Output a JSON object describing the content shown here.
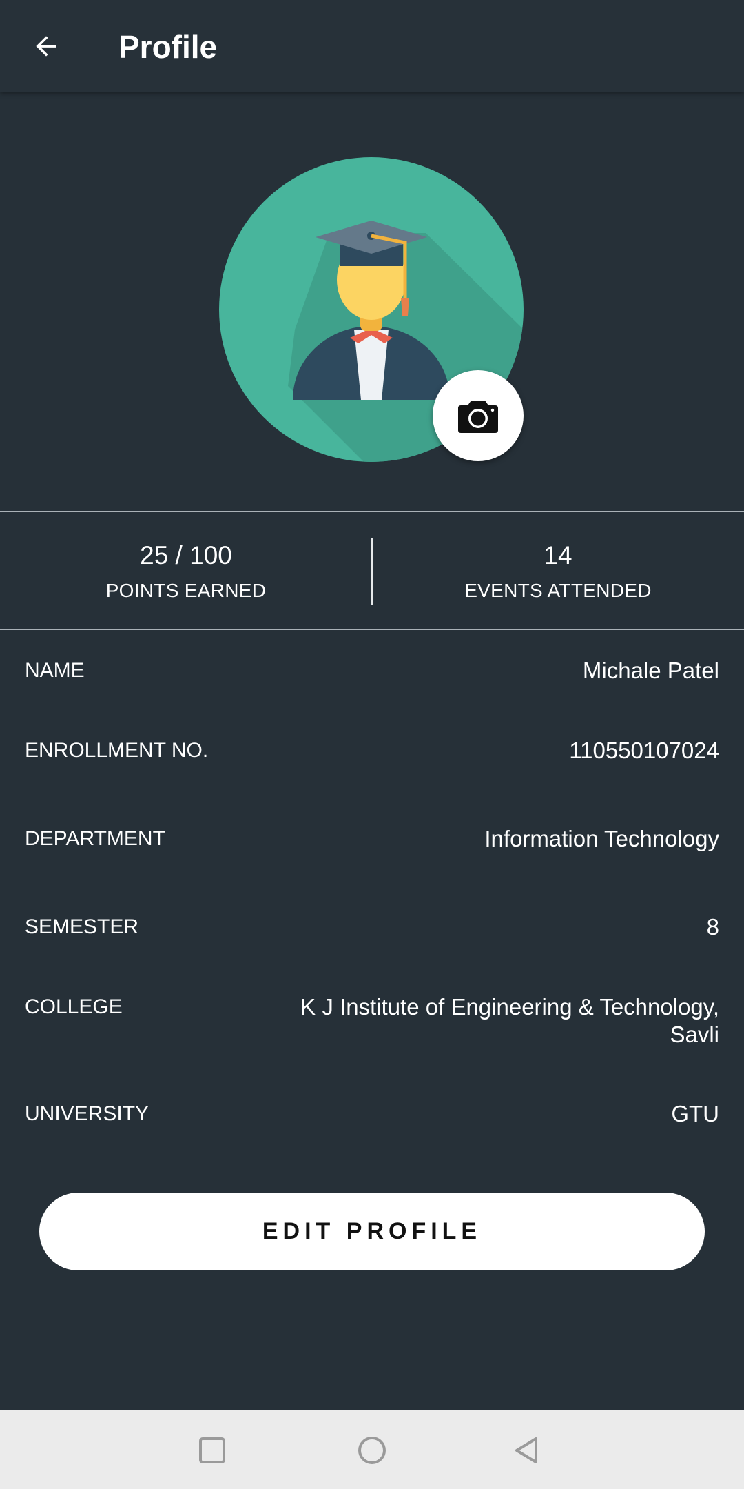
{
  "appbar": {
    "title": "Profile",
    "back_icon": "arrow-left-icon"
  },
  "avatar": {
    "icon": "graduate-avatar-icon",
    "camera_icon": "camera-icon",
    "colors": {
      "circle": "#48B59C",
      "shadow": "#3FA18B"
    }
  },
  "stats": [
    {
      "value": "25 / 100",
      "label": "POINTS EARNED"
    },
    {
      "value": "14",
      "label": "EVENTS ATTENDED"
    }
  ],
  "info": {
    "name": {
      "label": "NAME",
      "value": "Michale Patel"
    },
    "enrollment": {
      "label": "ENROLLMENT NO.",
      "value": "110550107024"
    },
    "department": {
      "label": "DEPARTMENT",
      "value": "Information Technology"
    },
    "semester": {
      "label": "SEMESTER",
      "value": "8"
    },
    "college": {
      "label": "COLLEGE",
      "value_line1": "K J Institute of Engineering & Technology,",
      "value_line2": "Savli"
    },
    "university": {
      "label": "UNIVERSITY",
      "value": "GTU"
    }
  },
  "edit_button": {
    "label": "EDIT PROFILE"
  },
  "navbar": {
    "recents_icon": "square-icon",
    "home_icon": "circle-icon",
    "back_icon": "triangle-back-icon"
  },
  "theme": {
    "background": "#263038",
    "appbar": "#273139",
    "text": "#FFFFFF"
  }
}
